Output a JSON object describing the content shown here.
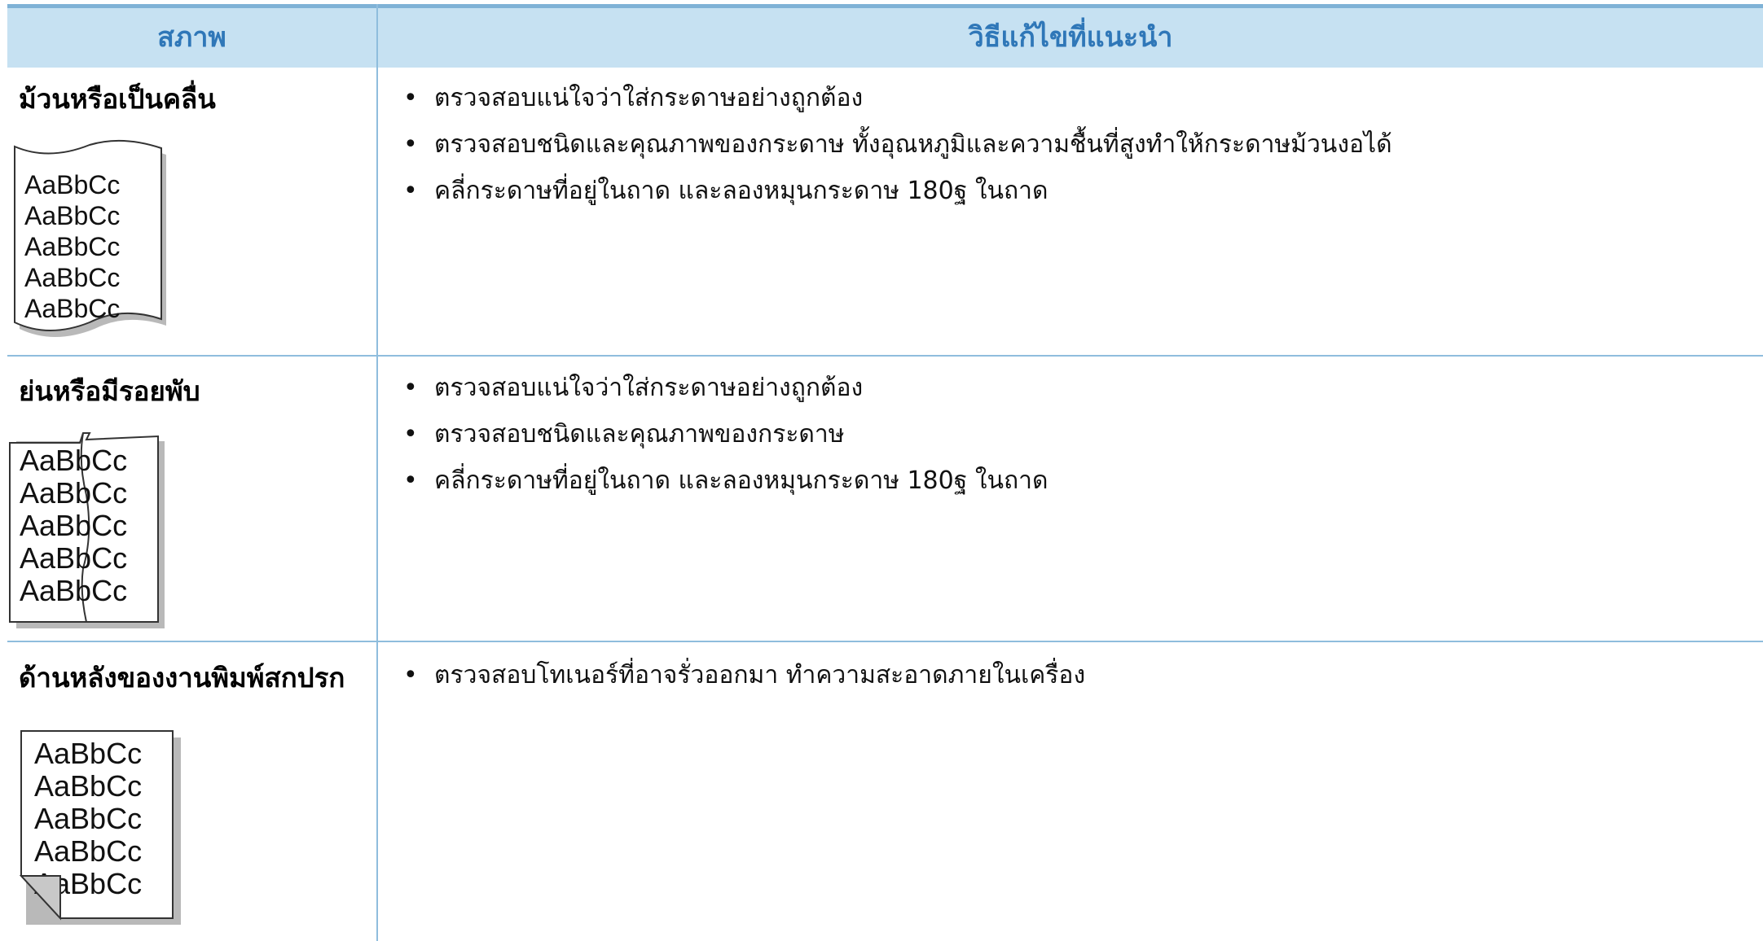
{
  "table": {
    "header": {
      "col_condition": "สภาพ",
      "col_solution": "วิธีแก้ไขที่แนะนำ"
    },
    "rows": [
      {
        "condition": "ม้วนหรือเป็นคลื่น",
        "image_icon": "curled-paper-sample-icon",
        "sample_lines": [
          "AaBbCc",
          "AaBbCc",
          "AaBbCc",
          "AaBbCc",
          "AaBbCc"
        ],
        "solutions": [
          "ตรวจสอบแน่ใจว่าใส่กระดาษอย่างถูกต้อง",
          "ตรวจสอบชนิดและคุณภาพของกระดาษ ทั้งอุณหภูมิและความชื้นที่สูงทำให้กระดาษม้วนงอได้",
          "คลี่กระดาษที่อยู่ในถาด และลองหมุนกระดาษ 180ฐ ในถาด"
        ]
      },
      {
        "condition": "ย่นหรือมีรอยพับ",
        "image_icon": "wrinkled-paper-sample-icon",
        "sample_lines": [
          "AaBbCc",
          "AaBbCc",
          "AaBbCc",
          "AaBbCc",
          "AaBbCc"
        ],
        "solutions": [
          "ตรวจสอบแน่ใจว่าใส่กระดาษอย่างถูกต้อง",
          "ตรวจสอบชนิดและคุณภาพของกระดาษ",
          "คลี่กระดาษที่อยู่ในถาด และลองหมุนกระดาษ 180ฐ ในถาด"
        ]
      },
      {
        "condition": "ด้านหลังของงานพิมพ์สกปรก",
        "image_icon": "dirty-back-paper-sample-icon",
        "sample_lines": [
          "AaBbCc",
          "AaBbCc",
          "AaBbCc",
          "AaBbCc",
          "AaBbCc"
        ],
        "solutions": [
          "ตรวจสอบโทเนอร์ที่อาจรั่วออกมา ทำความสะอาดภายในเครื่อง"
        ]
      }
    ]
  }
}
